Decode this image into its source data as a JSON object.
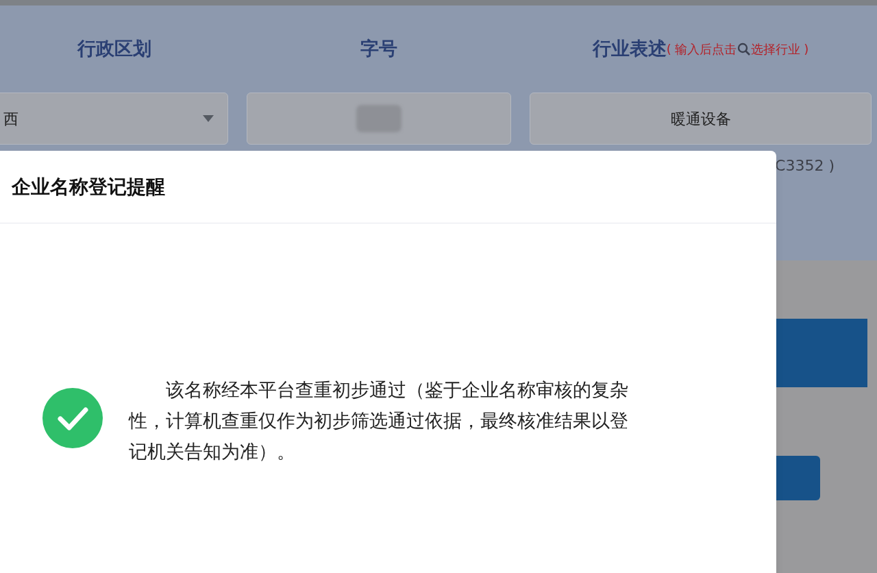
{
  "form": {
    "columns": [
      {
        "label": "行政区划",
        "field": {
          "kind": "select",
          "value": "西"
        }
      },
      {
        "label": "字号",
        "field": {
          "kind": "redacted"
        }
      },
      {
        "label": "行业表述",
        "hint_before": "( 输入后点击",
        "hint_after": "选择行业 )",
        "field": {
          "kind": "text",
          "value": "暖通设备"
        }
      }
    ],
    "industry_code": "C3352 )"
  },
  "dialog": {
    "title": "企业名称登记提醒",
    "passed": true,
    "message": "该名称经本平台查重初步通过（鉴于企业名称审核的复杂性，计算机查重仅作为初步筛选通过依据，最终核准结果以登记机关告知为准）。"
  }
}
